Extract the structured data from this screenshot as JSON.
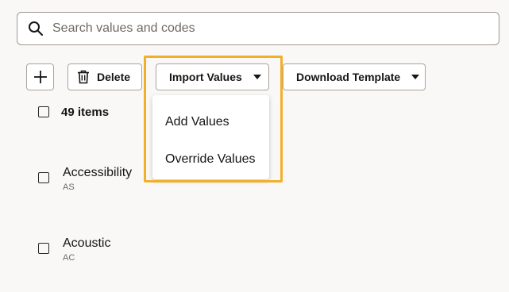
{
  "search": {
    "placeholder": "Search values and codes",
    "icon": "search-icon"
  },
  "toolbar": {
    "add_icon": "plus-icon",
    "delete_label": "Delete",
    "delete_icon": "trash-icon",
    "import_label": "Import Values",
    "download_label": "Download Template"
  },
  "import_menu": {
    "items": [
      {
        "label": "Add Values"
      },
      {
        "label": "Override Values"
      }
    ]
  },
  "list": {
    "count_label": "49 items",
    "rows": [
      {
        "label": "Accessibility",
        "code": "AS"
      },
      {
        "label": "Acoustic",
        "code": "AC"
      }
    ]
  },
  "colors": {
    "background": "#f9f8f6",
    "highlight": "#f2b02a",
    "border": "#9e9891",
    "text": "#161513",
    "muted_text": "#6f6a65"
  }
}
